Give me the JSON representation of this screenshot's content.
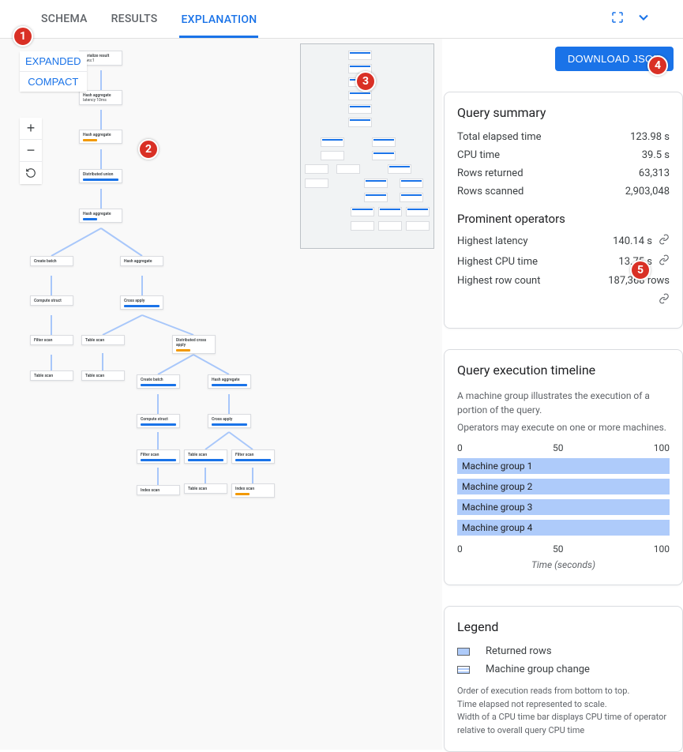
{
  "tabs": {
    "schema": "SCHEMA",
    "results": "RESULTS",
    "explanation": "EXPLANATION"
  },
  "view_modes": {
    "expanded": "EXPANDED",
    "compact": "COMPACT"
  },
  "download_button": "DOWNLOAD JSON",
  "summary": {
    "title": "Query summary",
    "rows": {
      "elapsed": {
        "k": "Total elapsed time",
        "v": "123.98 s"
      },
      "cpu": {
        "k": "CPU time",
        "v": "39.5 s"
      },
      "ret": {
        "k": "Rows returned",
        "v": "63,313"
      },
      "scan": {
        "k": "Rows scanned",
        "v": "2,903,048"
      }
    },
    "prominent_title": "Prominent operators",
    "prominent": {
      "latency": {
        "k": "Highest latency",
        "v": "140.14 s"
      },
      "cpu": {
        "k": "Highest CPU time",
        "v": "13.75 s"
      },
      "rows": {
        "k": "Highest row count",
        "v": "187,368 rows"
      }
    }
  },
  "timeline": {
    "title": "Query execution timeline",
    "desc1": "A machine group illustrates the execution of a portion of the query.",
    "desc2": "Operators may execute on one or more machines.",
    "axis": {
      "t0": "0",
      "t1": "50",
      "t2": "100"
    },
    "groups": [
      "Machine group 1",
      "Machine group 2",
      "Machine group 3",
      "Machine group 4"
    ],
    "xlabel": "Time (seconds)",
    "chart_data": {
      "type": "bar",
      "categories": [
        "Machine group 1",
        "Machine group 2",
        "Machine group 3",
        "Machine group 4"
      ],
      "values": [
        100,
        100,
        100,
        100
      ],
      "xlabel": "Time (seconds)",
      "xlim": [
        0,
        100
      ]
    }
  },
  "legend": {
    "title": "Legend",
    "returned": "Returned rows",
    "mgc": "Machine group change",
    "note1": "Order of execution reads from bottom to top.",
    "note2": "Time elapsed not represented to scale.",
    "note3": "Width of a CPU time bar displays CPU time of operator relative to overall query CPU time"
  },
  "callouts": {
    "c1": "1",
    "c2": "2",
    "c3": "3",
    "c4": "4",
    "c5": "5"
  },
  "plan_nodes": [
    "Serialize result",
    "Hash aggregate",
    "Hash aggregate",
    "Distributed union",
    "Hash aggregate",
    "Distributed cross apply",
    "Create batch",
    "Hash aggregate",
    "Compute struct",
    "Cross apply",
    "Filter scan",
    "Table scan",
    "Table scan",
    "Create batch",
    "Compute struct",
    "Filter scan",
    "Table scan",
    "Index scan",
    "Cross apply",
    "Filter scan",
    "Table scan",
    "Index scan",
    "Index scan"
  ]
}
